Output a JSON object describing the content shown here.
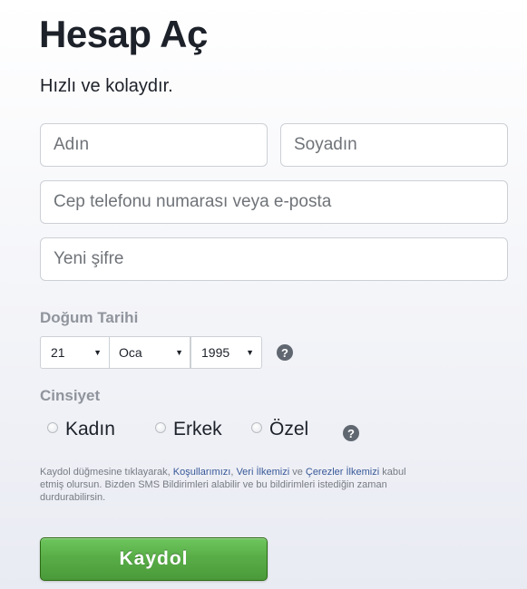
{
  "header": {
    "title": "Hesap Aç",
    "subtitle": "Hızlı ve kolaydır."
  },
  "form": {
    "first_name_placeholder": "Adın",
    "last_name_placeholder": "Soyadın",
    "contact_placeholder": "Cep telefonu numarası veya e-posta",
    "password_placeholder": "Yeni şifre"
  },
  "birthday": {
    "label": "Doğum Tarihi",
    "day": "21",
    "month": "Oca",
    "year": "1995",
    "caret": "▼",
    "help_icon": "question-icon",
    "help_glyph": "?"
  },
  "gender": {
    "label": "Cinsiyet",
    "options": [
      "Kadın",
      "Erkek",
      "Özel"
    ],
    "help_glyph": "?"
  },
  "terms": {
    "text_1": "Kaydol düğmesine tıklayarak, ",
    "link_terms": "Koşullarımızı",
    "sep_1": ", ",
    "link_data": "Veri İlkemizi",
    "text_2": " ve ",
    "link_cookies": "Çerezler İlkemizi",
    "text_3": " kabul etmiş olursun. Bizden SMS Bildirimleri alabilir ve bu bildirimleri istediğin zaman durdurabilirsin."
  },
  "actions": {
    "signup_label": "Kaydol"
  },
  "colors": {
    "signup_button": "#59ad47",
    "link": "#385898",
    "muted_label": "#90949c"
  }
}
